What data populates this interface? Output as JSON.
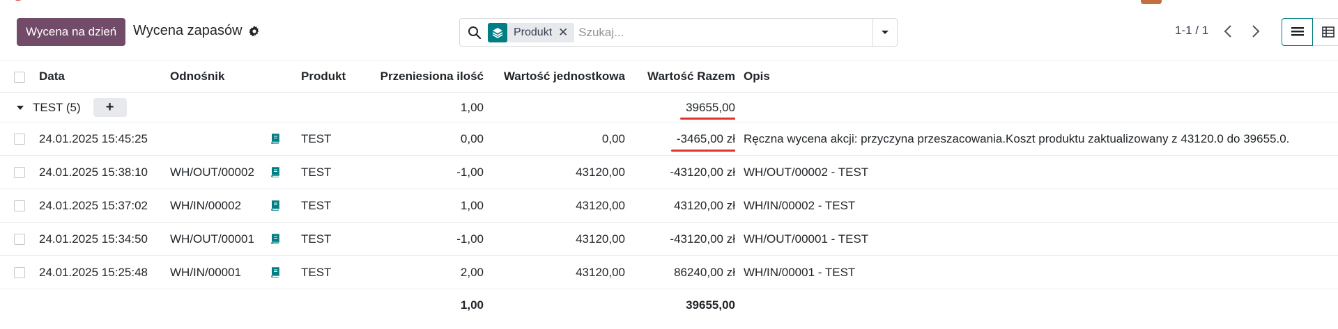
{
  "control_panel": {
    "primary_button": "Wycena na dzień",
    "title": "Wycena zapasów",
    "search": {
      "facet_label": "Produkt",
      "facet_remove": "✕",
      "placeholder": "Szukaj..."
    },
    "pager": "1-1 / 1",
    "views": [
      "list",
      "pivot"
    ],
    "active_view": "list"
  },
  "table": {
    "columns": [
      "Data",
      "Odnośnik",
      "Produkt",
      "Przeniesiona ilość",
      "Wartość jednostkowa",
      "Wartość Razem",
      "Opis"
    ],
    "group": {
      "label": "TEST (5)",
      "add": "+",
      "qty": "1,00",
      "total": "39655,00"
    },
    "rows": [
      {
        "date": "24.01.2025 15:45:25",
        "ref": "",
        "product": "TEST",
        "qty": "0,00",
        "unit": "0,00",
        "total": "-3465,00 zł",
        "desc": "Ręczna wycena akcji: przyczyna przeszacowania.Koszt produktu zaktualizowany z 43120.0 do 39655.0."
      },
      {
        "date": "24.01.2025 15:38:10",
        "ref": "WH/OUT/00002",
        "product": "TEST",
        "qty": "-1,00",
        "unit": "43120,00",
        "total": "-43120,00 zł",
        "desc": "WH/OUT/00002 - TEST"
      },
      {
        "date": "24.01.2025 15:37:02",
        "ref": "WH/IN/00002",
        "product": "TEST",
        "qty": "1,00",
        "unit": "43120,00",
        "total": "43120,00 zł",
        "desc": "WH/IN/00002 - TEST"
      },
      {
        "date": "24.01.2025 15:34:50",
        "ref": "WH/OUT/00001",
        "product": "TEST",
        "qty": "-1,00",
        "unit": "43120,00",
        "total": "-43120,00 zł",
        "desc": "WH/OUT/00001 - TEST"
      },
      {
        "date": "24.01.2025 15:25:48",
        "ref": "WH/IN/00001",
        "product": "TEST",
        "qty": "2,00",
        "unit": "43120,00",
        "total": "86240,00 zł",
        "desc": "WH/IN/00001 - TEST"
      }
    ],
    "footer": {
      "qty": "1,00",
      "total": "39655,00"
    }
  },
  "colors": {
    "brand": "#714b67",
    "accent": "#017e84",
    "highlight": "#e03131"
  },
  "icons": [
    "search-icon",
    "gear-icon",
    "layers-icon",
    "caret-down-icon",
    "chevron-left-icon",
    "chevron-right-icon",
    "list-view-icon",
    "pivot-view-icon",
    "book-icon"
  ]
}
